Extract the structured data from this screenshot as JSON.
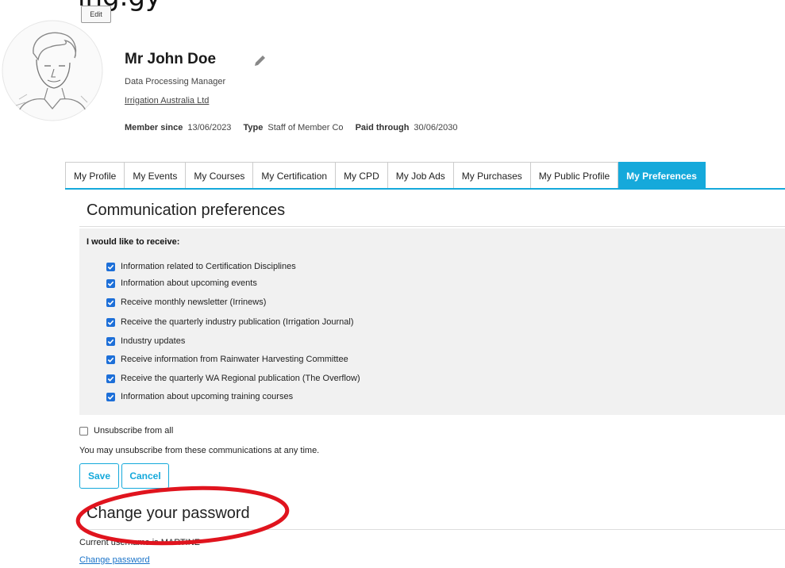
{
  "page": {
    "partial_heading": "ing.gy",
    "edit_label": "Edit"
  },
  "profile": {
    "name": "Mr John Doe",
    "role": "Data Processing Manager",
    "organisation": "Irrigation Australia Ltd",
    "member_since_label": "Member since",
    "member_since": "13/06/2023",
    "type_label": "Type",
    "type": "Staff of Member Co",
    "paid_through_label": "Paid through",
    "paid_through": "30/06/2030"
  },
  "tabs": [
    {
      "label": "My Profile",
      "active": false
    },
    {
      "label": "My Events",
      "active": false
    },
    {
      "label": "My Courses",
      "active": false
    },
    {
      "label": "My Certification",
      "active": false
    },
    {
      "label": "My CPD",
      "active": false
    },
    {
      "label": "My Job Ads",
      "active": false
    },
    {
      "label": "My Purchases",
      "active": false
    },
    {
      "label": "My Public Profile",
      "active": false
    },
    {
      "label": "My Preferences",
      "active": true
    }
  ],
  "communication": {
    "title": "Communication preferences",
    "receive_heading": "I would like to receive:",
    "items": [
      {
        "label": "Information related to Certification Disciplines",
        "checked": true
      },
      {
        "label": "Information about upcoming events",
        "checked": true
      },
      {
        "label": "Receive monthly newsletter (Irrinews)",
        "checked": true
      },
      {
        "label": "Receive the quarterly industry publication (Irrigation Journal)",
        "checked": true
      },
      {
        "label": "Industry updates",
        "checked": true
      },
      {
        "label": "Receive information from Rainwater Harvesting Committee",
        "checked": true
      },
      {
        "label": "Receive the quarterly WA Regional publication (The Overflow)",
        "checked": true
      },
      {
        "label": "Information about upcoming training courses",
        "checked": true
      }
    ],
    "unsubscribe_label": "Unsubscribe from all",
    "unsubscribe_checked": false,
    "unsubscribe_note": "You may unsubscribe from these communications at any time.",
    "save_label": "Save",
    "cancel_label": "Cancel"
  },
  "password": {
    "title": "Change your password",
    "current_username_text": "Current username is MARTINE",
    "change_link": "Change password"
  },
  "colors": {
    "accent": "#15a9db",
    "checkbox": "#1d6fd8",
    "annotation": "#e0141e",
    "link": "#1a73c9"
  }
}
